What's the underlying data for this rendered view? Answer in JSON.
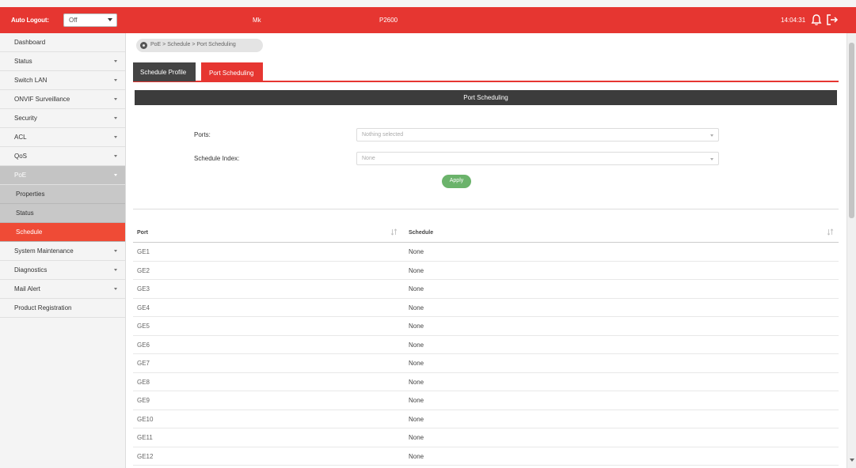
{
  "header": {
    "auto_logout_label": "Auto Logout:",
    "auto_logout_value": "Off",
    "host": "Mk",
    "model": "P2600",
    "time": "14:04:31",
    "bell_icon": "bell-icon",
    "logout_icon": "logout-icon",
    "bar_color": "#e63631"
  },
  "sidebar": {
    "items": [
      {
        "label": "Dashboard"
      },
      {
        "label": "Status"
      },
      {
        "label": "Switch LAN"
      },
      {
        "label": "ONVIF Surveillance"
      },
      {
        "label": "Security"
      },
      {
        "label": "ACL"
      },
      {
        "label": "QoS"
      },
      {
        "label": "PoE"
      },
      {
        "label": "Properties"
      },
      {
        "label": "Status"
      },
      {
        "label": "Schedule"
      },
      {
        "label": "System Maintenance"
      },
      {
        "label": "Diagnostics"
      },
      {
        "label": "Mail Alert"
      },
      {
        "label": "Product Registration"
      }
    ],
    "selected_color": "#ef4b36"
  },
  "breadcrumb": {
    "text": "PoE > Schedule  > Port Scheduling",
    "icon": "location-icon"
  },
  "tabs": [
    {
      "label": "Schedule Profile"
    },
    {
      "label": "Port Scheduling"
    }
  ],
  "section": {
    "title": "Port Scheduling"
  },
  "form": {
    "ports_label": "Ports:",
    "ports_placeholder": "Nothing selected",
    "schedule_index_label": "Schedule Index:",
    "schedule_index_value": "None",
    "apply_label": "Apply",
    "apply_color": "#6bb36b"
  },
  "table": {
    "headers": {
      "port": "Port",
      "schedule": "Schedule"
    },
    "rows": [
      {
        "port": "GE1",
        "schedule": "None"
      },
      {
        "port": "GE2",
        "schedule": "None"
      },
      {
        "port": "GE3",
        "schedule": "None"
      },
      {
        "port": "GE4",
        "schedule": "None"
      },
      {
        "port": "GE5",
        "schedule": "None"
      },
      {
        "port": "GE6",
        "schedule": "None"
      },
      {
        "port": "GE7",
        "schedule": "None"
      },
      {
        "port": "GE8",
        "schedule": "None"
      },
      {
        "port": "GE9",
        "schedule": "None"
      },
      {
        "port": "GE10",
        "schedule": "None"
      },
      {
        "port": "GE11",
        "schedule": "None"
      },
      {
        "port": "GE12",
        "schedule": "None"
      }
    ]
  }
}
